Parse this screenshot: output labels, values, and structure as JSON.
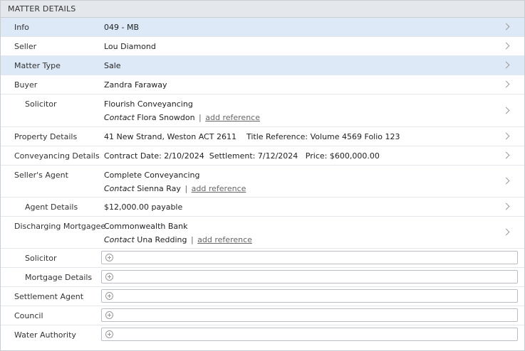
{
  "header": {
    "title": "MATTER DETAILS"
  },
  "rows": {
    "info": {
      "label": "Info",
      "value": "049 - MB"
    },
    "seller": {
      "label": "Seller",
      "value": "Lou Diamond"
    },
    "matter_type": {
      "label": "Matter Type",
      "value": "Sale"
    },
    "buyer": {
      "label": "Buyer",
      "value": "Zandra Faraway"
    },
    "buyer_solicitor": {
      "label": "Solicitor",
      "value": "Flourish Conveyancing",
      "contact_label": "Contact",
      "contact_name": "Flora Snowdon",
      "separator": "|",
      "add_reference": "add reference"
    },
    "property_details": {
      "label": "Property Details",
      "address": "41 New Strand, Weston ACT 2611",
      "title_reference": "Title Reference: Volume 4569 Folio 123"
    },
    "conveyancing_details": {
      "label": "Conveyancing Details",
      "contract_date": "Contract Date: 2/10/2024",
      "settlement": "Settlement: 7/12/2024",
      "price": "Price: $600,000.00"
    },
    "sellers_agent": {
      "label": "Seller's Agent",
      "value": "Complete Conveyancing",
      "contact_label": "Contact",
      "contact_name": "Sienna Ray",
      "separator": "|",
      "add_reference": "add reference"
    },
    "agent_details": {
      "label": "Agent Details",
      "value": "$12,000.00 payable"
    },
    "discharging_mortgagee": {
      "label": "Discharging Mortgagee",
      "value": "Commonwealth Bank",
      "contact_label": "Contact",
      "contact_name": "Una Redding",
      "separator": "|",
      "add_reference": "add reference"
    },
    "mortgagee_solicitor": {
      "label": "Solicitor"
    },
    "mortgage_details": {
      "label": "Mortgage Details"
    },
    "settlement_agent": {
      "label": "Settlement Agent"
    },
    "council": {
      "label": "Council"
    },
    "water_authority": {
      "label": "Water Authority"
    }
  },
  "icons": {
    "chevron": "chevron-right-icon",
    "add": "plus-circle-icon"
  },
  "colors": {
    "highlight": "#dde9f6",
    "header_bg": "#e4e7eb"
  }
}
